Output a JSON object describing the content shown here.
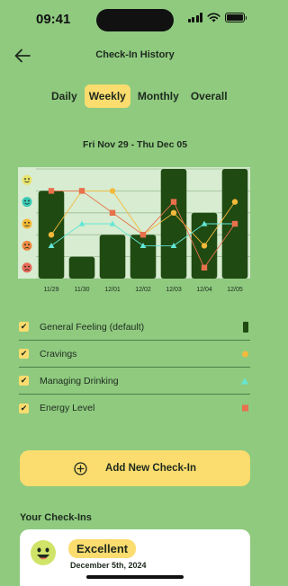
{
  "status": {
    "time": "09:41"
  },
  "nav": {
    "title": "Check-In History"
  },
  "tabs": [
    "Daily",
    "Weekly",
    "Monthly",
    "Overall"
  ],
  "active_tab": "Weekly",
  "date_range": "Fri Nov 29 - Thu Dec 05",
  "chart_data": {
    "type": "bar",
    "categories": [
      "11/29",
      "11/30",
      "12/01",
      "12/02",
      "12/03",
      "12/04",
      "12/05"
    ],
    "y_levels": [
      "Excellent",
      "Good",
      "Okay",
      "Poor",
      "Bad"
    ],
    "ylim": [
      0,
      5
    ],
    "grid": true,
    "series": [
      {
        "name": "General Feeling (default)",
        "kind": "bar",
        "color": "#1f4a12",
        "values": [
          4,
          1,
          2,
          2,
          5,
          3,
          5
        ]
      },
      {
        "name": "Cravings",
        "kind": "line",
        "marker": "circle",
        "color": "#f4b93a",
        "values": [
          2,
          4,
          4,
          2,
          3,
          1.5,
          3.5
        ]
      },
      {
        "name": "Managing Drinking",
        "kind": "line",
        "marker": "triangle",
        "color": "#63e6d6",
        "values": [
          1.5,
          2.5,
          2.5,
          1.5,
          1.5,
          2.5,
          2.5
        ]
      },
      {
        "name": "Energy Level",
        "kind": "line",
        "marker": "square",
        "color": "#e8704c",
        "values": [
          4,
          4,
          3,
          2,
          3.5,
          0.5,
          2.5
        ]
      }
    ],
    "face_colors": [
      "#e9e36b",
      "#38c9b5",
      "#f4b93a",
      "#ee8a44",
      "#e86a5a"
    ]
  },
  "legend": [
    {
      "label": "General Feeling (default)",
      "checked": true
    },
    {
      "label": "Cravings",
      "checked": true
    },
    {
      "label": "Managing Drinking",
      "checked": true
    },
    {
      "label": "Energy Level",
      "checked": true
    }
  ],
  "checkbox_mark": "✔",
  "add_button": {
    "label": "Add New Check-In"
  },
  "section_title": "Your Check-Ins",
  "checkin": {
    "rating": "Excellent",
    "date": "December 5th, 2024"
  },
  "colors": {
    "background": "#8fca7f",
    "accent": "#fbdc6e",
    "bar": "#1f4a12",
    "chart_bg": "#d7ecd0"
  }
}
